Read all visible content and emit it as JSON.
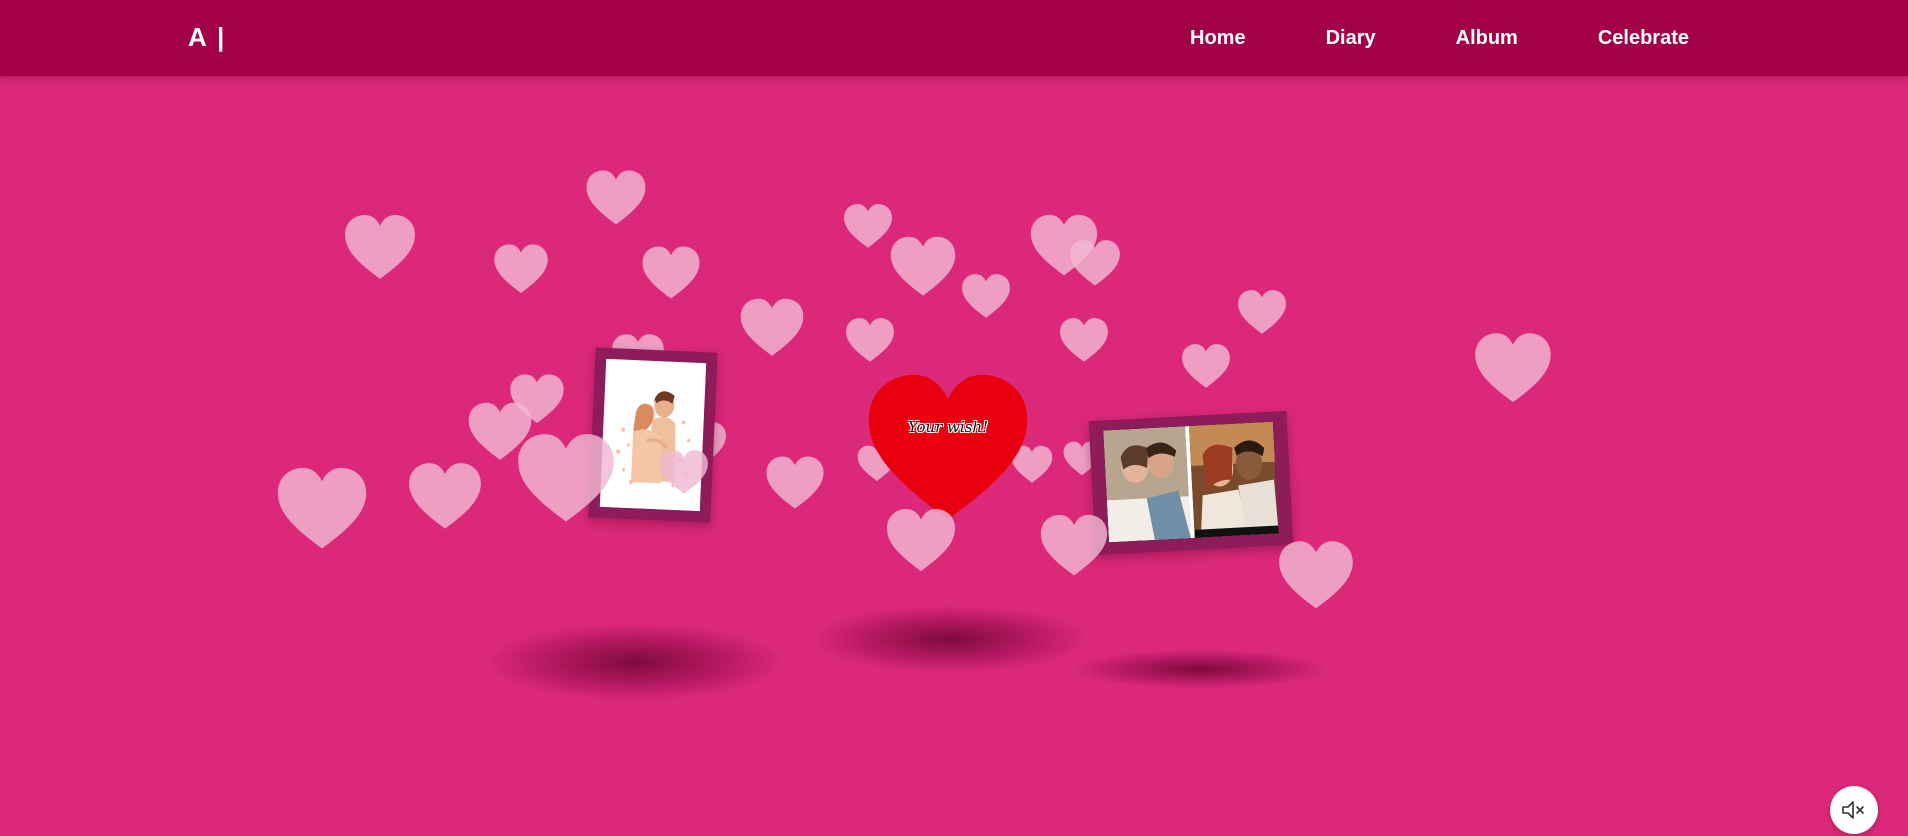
{
  "brand": {
    "logo_text": "A |"
  },
  "nav": {
    "items": [
      {
        "label": "Home"
      },
      {
        "label": "Diary"
      },
      {
        "label": "Album"
      },
      {
        "label": "Celebrate"
      }
    ]
  },
  "center_heart": {
    "text": "Your wish!",
    "color": "#e8000f"
  },
  "photo_frames": [
    {
      "icon": "couple-illustration-icon"
    },
    {
      "icon": "couple-photos-icon"
    }
  ],
  "audio": {
    "muted": true,
    "icon": "speaker-muted-icon"
  },
  "colors": {
    "background": "#db2878",
    "navbar": "#a3004a",
    "floating_hearts": "#f0b8d2",
    "frame": "#8e1c5a"
  }
}
